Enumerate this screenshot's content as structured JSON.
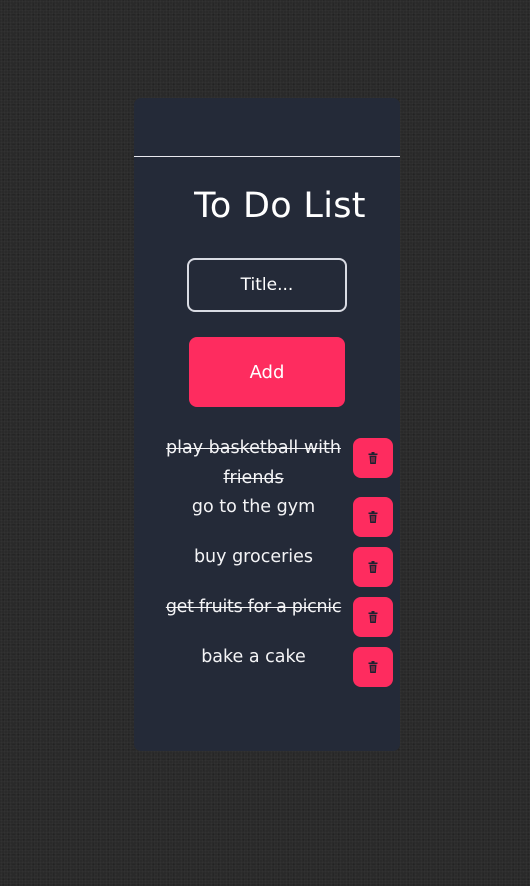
{
  "app": {
    "title": "To Do List",
    "colors": {
      "background": "#2a2a2a",
      "card": "#242a38",
      "accent": "#fe2c5f",
      "text": "#ffffff"
    }
  },
  "form": {
    "title_input": {
      "placeholder": "Title...",
      "value": ""
    },
    "add_label": "Add"
  },
  "todos": [
    {
      "text": "play basketball with friends",
      "completed": true,
      "delete_icon": "trash-icon"
    },
    {
      "text": "go to the gym",
      "completed": false,
      "delete_icon": "trash-icon"
    },
    {
      "text": "buy groceries",
      "completed": false,
      "delete_icon": "trash-icon"
    },
    {
      "text": "get fruits for a picnic",
      "completed": true,
      "delete_icon": "trash-icon"
    },
    {
      "text": "bake a cake",
      "completed": false,
      "delete_icon": "trash-icon"
    }
  ]
}
